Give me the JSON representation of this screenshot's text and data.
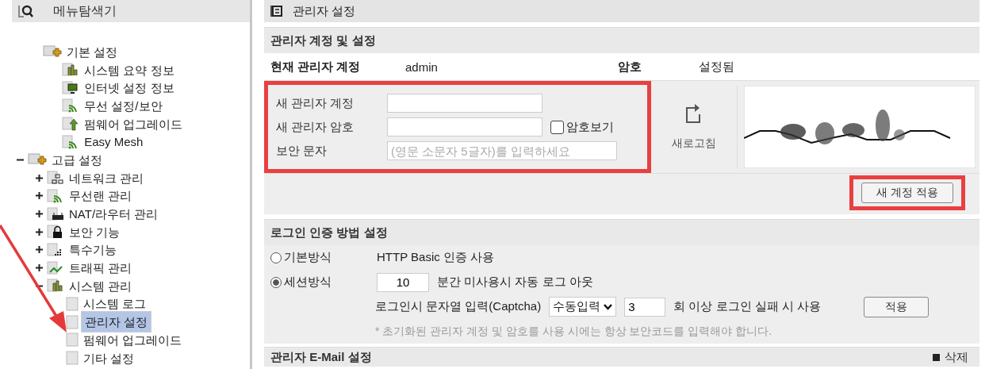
{
  "sidebar": {
    "title": "메뉴탐색기",
    "tree": [
      {
        "label": "기본 설정",
        "kind": "folder-plus",
        "selected": false,
        "children": [
          {
            "label": "시스템 요약 정보",
            "kind": "chart",
            "selected": false
          },
          {
            "label": "인터넷 설정 정보",
            "kind": "monitor",
            "selected": false
          },
          {
            "label": "무선 설정/보안",
            "kind": "wifi",
            "selected": false
          },
          {
            "label": "펌웨어 업그레이드",
            "kind": "upload",
            "selected": false
          },
          {
            "label": "Easy Mesh",
            "kind": "wifi",
            "selected": false
          }
        ]
      },
      {
        "label": "고급 설정",
        "kind": "folder-plus",
        "selected": false,
        "expanded": true,
        "children": [
          {
            "label": "네트워크 관리",
            "kind": "network",
            "selected": false,
            "expanded": false
          },
          {
            "label": "무선랜 관리",
            "kind": "wifi",
            "selected": false,
            "expanded": false
          },
          {
            "label": "NAT/라우터 관리",
            "kind": "router",
            "selected": false,
            "expanded": false
          },
          {
            "label": "보안 기능",
            "kind": "lock",
            "selected": false,
            "expanded": false
          },
          {
            "label": "특수기능",
            "kind": "dots",
            "selected": false,
            "expanded": false
          },
          {
            "label": "트래픽 관리",
            "kind": "traffic",
            "selected": false,
            "expanded": false
          },
          {
            "label": "시스템 관리",
            "kind": "chart",
            "selected": false,
            "expanded": true,
            "children": [
              {
                "label": "시스템 로그",
                "kind": "page",
                "selected": false
              },
              {
                "label": "관리자 설정",
                "kind": "page",
                "selected": true,
                "pointed": true
              },
              {
                "label": "펌웨어 업그레이드",
                "kind": "page",
                "selected": false
              },
              {
                "label": "기타 설정",
                "kind": "page",
                "selected": false
              }
            ]
          }
        ]
      }
    ]
  },
  "page_title": "관리자 설정",
  "account_section": {
    "title": "관리자 계정 및 설정",
    "current_label": "현재 관리자 계정",
    "current_value": "admin",
    "password_label": "암호",
    "password_value": "설정됨",
    "highlighted": true,
    "fields": [
      {
        "label": "새 관리자 계정"
      },
      {
        "label": "새 관리자 암호",
        "show_password": {
          "label": "암호보기",
          "checked": false
        }
      },
      {
        "label": "보안 문자",
        "placeholder": "(영문 소문자 5글자)를 입력하세요"
      }
    ],
    "refresh_label": "새로고침",
    "apply_button": {
      "label": "새 계정 적용",
      "highlighted": true
    }
  },
  "login_section": {
    "title": "로그인 인증 방법 설정",
    "options": [
      {
        "label": "기본방식",
        "selected": false,
        "description": "HTTP Basic 인증 사용"
      },
      {
        "label": "세션방식",
        "selected": true,
        "timeout_value": "10",
        "timeout_suffix": "분간 미사용시 자동 로그 아웃"
      }
    ],
    "captcha_label": "로그인시 문자열 입력(Captcha)",
    "captcha_mode": "수동입력",
    "fail_count": "3",
    "fail_suffix": "회 이상 로그인 실패 시 사용",
    "apply_label": "적용",
    "note": "* 초기화된 관리자 계정 및 암호를 사용 시에는 항상 보안코드를 입력해야 합니다."
  },
  "email_section": {
    "title": "관리자 E-Mail 설정",
    "delete_label": "삭제"
  }
}
